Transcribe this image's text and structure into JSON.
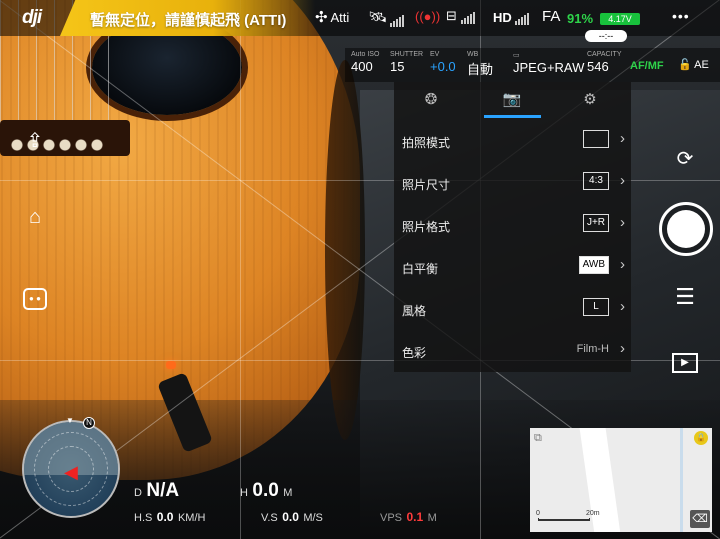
{
  "topbar": {
    "logo": "dji",
    "warning": "暫無定位，請謹慎起飛 (ATTI)",
    "flight_mode": "Atti",
    "video_link": "HD",
    "battery_percent": "91%",
    "battery_voltage": "4.17V",
    "flight_time": "--:--",
    "more_label": "•••",
    "accent_color": "#f5c518"
  },
  "camera_params": {
    "iso_label": "Auto ISO",
    "iso_value": "400",
    "shutter_label": "SHUTTER",
    "shutter_value": "15",
    "ev_label": "EV",
    "ev_value": "+0.0",
    "wb_label": "WB",
    "wb_value": "自動",
    "format_value": "JPEG+RAW",
    "capacity_label": "CAPACITY",
    "capacity_value": "546",
    "af_mf": "AF/MF",
    "ae_lock": "AE"
  },
  "settings_panel": {
    "tabs": [
      {
        "icon": "aperture-icon"
      },
      {
        "icon": "camera-icon",
        "active": true
      },
      {
        "icon": "gear-icon"
      }
    ],
    "rows": [
      {
        "label": "拍照模式",
        "value": ""
      },
      {
        "label": "照片尺寸",
        "value": "4:3"
      },
      {
        "label": "照片格式",
        "value": "J+R"
      },
      {
        "label": "白平衡",
        "value": "AWB"
      },
      {
        "label": "風格",
        "value": "L"
      },
      {
        "label": "色彩",
        "value": "Film-H"
      }
    ]
  },
  "telemetry": {
    "distance_label": "D",
    "distance_value": "N/A",
    "height_label": "H",
    "height_value": "0.0",
    "height_unit": "M",
    "hspeed_label": "H.S",
    "hspeed_value": "0.0",
    "hspeed_unit": "KM/H",
    "vspeed_label": "V.S",
    "vspeed_value": "0.0",
    "vspeed_unit": "M/S",
    "vps_label": "VPS",
    "vps_value": "0.1",
    "vps_unit": "M"
  },
  "radar": {
    "north_label": "N"
  },
  "map": {
    "scale_start": "0",
    "scale_end": "20m"
  }
}
